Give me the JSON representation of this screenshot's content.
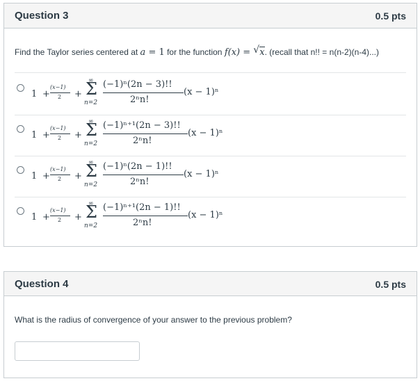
{
  "q3": {
    "title": "Question 3",
    "points": "0.5 pts",
    "prompt_before": "Find the Taylor series centered at ",
    "center_lhs": "a",
    "center_eq": " = 1",
    "prompt_mid": " for the function ",
    "func_lhs": "f(x) = ",
    "func_rad": "√",
    "func_arg": "x",
    "prompt_after": ". (recall that n!! = n(n-2)(n-4)...)",
    "answers": [
      {
        "one": "1",
        "plus": "+",
        "small_num": "(x−1)",
        "small_den": "2",
        "plus2": "+",
        "upper": "∞",
        "sigma": "Σ",
        "lower": "n=2",
        "num": "(−1)ⁿ(2n − 3)!!",
        "den": "2ⁿn!",
        "factor": "(x − 1)ⁿ"
      },
      {
        "one": "1",
        "plus": "+",
        "small_num": "(x−1)",
        "small_den": "2",
        "plus2": "+",
        "upper": "∞",
        "sigma": "Σ",
        "lower": "n=2",
        "num": "(−1)ⁿ⁺¹(2n − 3)!!",
        "den": "2ⁿn!",
        "factor": "(x − 1)ⁿ"
      },
      {
        "one": "1",
        "plus": "+",
        "small_num": "(x−1)",
        "small_den": "2",
        "plus2": "+",
        "upper": "∞",
        "sigma": "Σ",
        "lower": "n=2",
        "num": "(−1)ⁿ(2n − 1)!!",
        "den": "2ⁿn!",
        "factor": "(x − 1)ⁿ"
      },
      {
        "one": "1",
        "plus": "+",
        "small_num": "(x−1)",
        "small_den": "2",
        "plus2": "+",
        "upper": "∞",
        "sigma": "Σ",
        "lower": "n=2",
        "num": "(−1)ⁿ⁺¹(2n − 1)!!",
        "den": "2ⁿn!",
        "factor": "(x − 1)ⁿ"
      }
    ]
  },
  "q4": {
    "title": "Question 4",
    "points": "0.5 pts",
    "prompt": "What is the radius of convergence of your answer to the previous problem?",
    "answer_value": ""
  }
}
